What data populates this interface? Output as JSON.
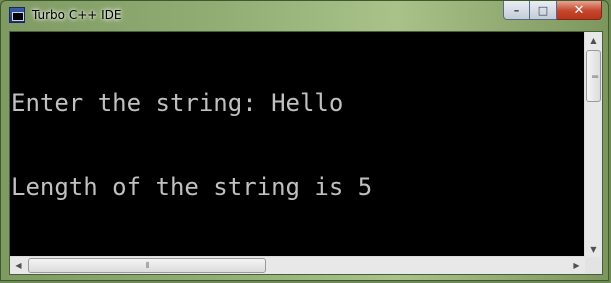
{
  "window": {
    "title": "Turbo C++ IDE",
    "controls": {
      "minimize": "–",
      "maximize": "□",
      "close": "✕"
    },
    "icons": {
      "app": "console-window-icon"
    }
  },
  "console": {
    "lines": [
      "Enter the string: Hello",
      "Length of the string is 5"
    ],
    "text_color": "#c0c0c0",
    "background": "#000000"
  },
  "scrollbars": {
    "up": "▲",
    "down": "▼",
    "left": "◀",
    "right": "▶",
    "grip": "⦀"
  }
}
